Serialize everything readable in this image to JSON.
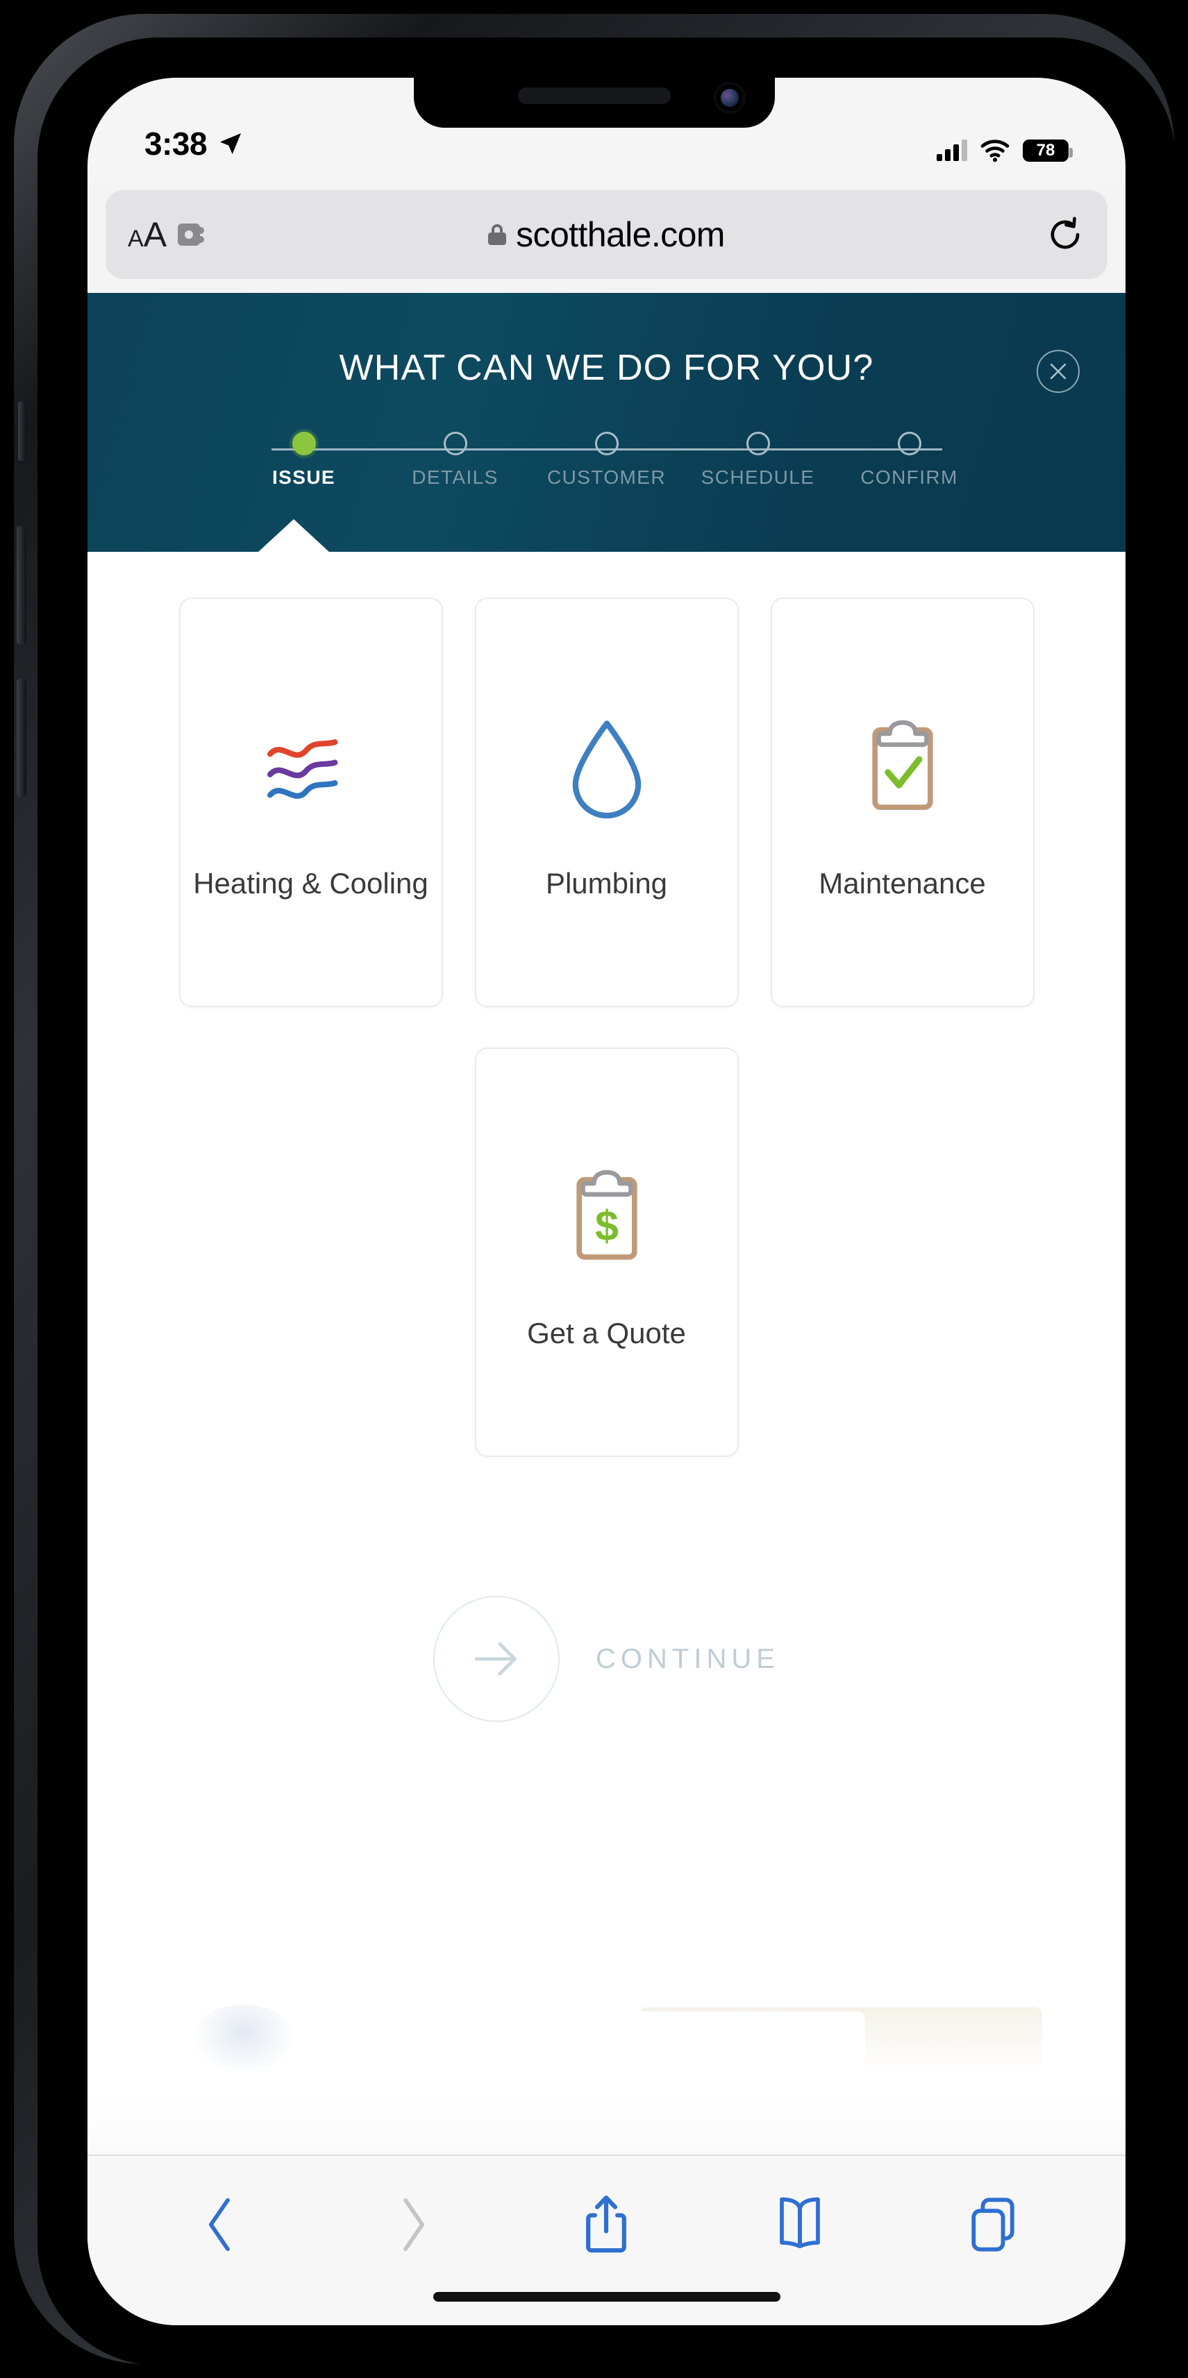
{
  "status_bar": {
    "time": "3:38",
    "location_icon": "location-arrow-icon",
    "signal_icon": "cellular-signal-icon",
    "wifi_icon": "wifi-icon",
    "battery_level": "78"
  },
  "browser": {
    "text_size_label_small": "A",
    "text_size_label_large": "A",
    "extensions_icon": "puzzle-extension-icon",
    "lock_icon": "lock-icon",
    "url": "scotthale.com",
    "reload_icon": "reload-icon",
    "toolbar": {
      "back_label": "back-icon",
      "forward_label": "forward-icon",
      "share_label": "share-icon",
      "bookmarks_label": "bookmarks-icon",
      "tabs_label": "tabs-icon"
    }
  },
  "booking": {
    "title": "WHAT CAN WE DO FOR YOU?",
    "close_label": "close-icon",
    "accent_green": "#8cc63e",
    "header_background": "#0c4257",
    "steps": [
      {
        "label": "ISSUE",
        "active": true
      },
      {
        "label": "DETAILS",
        "active": false
      },
      {
        "label": "CUSTOMER",
        "active": false
      },
      {
        "label": "SCHEDULE",
        "active": false
      },
      {
        "label": "CONFIRM",
        "active": false
      }
    ],
    "services_row1": [
      {
        "label": "Heating & Cooling",
        "icon": "hvac-waves-icon"
      },
      {
        "label": "Plumbing",
        "icon": "water-droplet-icon"
      },
      {
        "label": "Maintenance",
        "icon": "clipboard-check-icon"
      }
    ],
    "services_row2": [
      {
        "label": "Get a Quote",
        "icon": "clipboard-dollar-icon"
      }
    ],
    "continue_label": "CONTINUE",
    "continue_icon": "arrow-right-icon"
  }
}
